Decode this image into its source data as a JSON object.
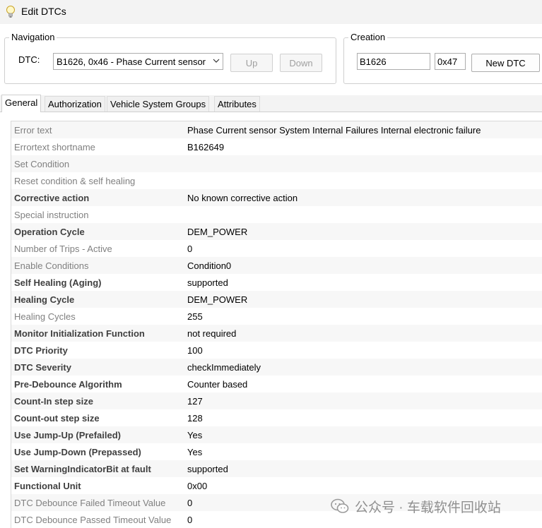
{
  "window": {
    "title": "Edit DTCs",
    "icon": "lightbulb-icon"
  },
  "navigation": {
    "legend": "Navigation",
    "dtc_label": "DTC:",
    "dtc_selected": "B1626, 0x46 - Phase Current sensor",
    "up_label": "Up",
    "down_label": "Down"
  },
  "creation": {
    "legend": "Creation",
    "code_value": "B1626",
    "byte_value": "0x47",
    "new_label": "New DTC"
  },
  "tabs": [
    {
      "label": "General",
      "active": true
    },
    {
      "label": "Authorization",
      "active": false
    },
    {
      "label": "Vehicle System Groups",
      "active": false
    },
    {
      "label": "Attributes",
      "active": false
    }
  ],
  "properties": [
    {
      "name": "Error text",
      "value": "Phase Current sensor System Internal Failures Internal electronic failure",
      "bold": false
    },
    {
      "name": "Errortext shortname",
      "value": "B162649",
      "bold": false
    },
    {
      "name": "Set Condition",
      "value": "",
      "bold": false
    },
    {
      "name": "Reset condition & self healing",
      "value": "",
      "bold": false
    },
    {
      "name": "Corrective action",
      "value": "No known corrective action",
      "bold": true
    },
    {
      "name": "Special instruction",
      "value": "",
      "bold": false
    },
    {
      "name": "Operation Cycle",
      "value": "DEM_POWER",
      "bold": true
    },
    {
      "name": "Number of Trips - Active",
      "value": "0",
      "bold": false
    },
    {
      "name": "Enable Conditions",
      "value": "Condition0",
      "bold": false
    },
    {
      "name": "Self Healing (Aging)",
      "value": "supported",
      "bold": true
    },
    {
      "name": "Healing Cycle",
      "value": "DEM_POWER",
      "bold": true
    },
    {
      "name": "Healing Cycles",
      "value": "255",
      "bold": false
    },
    {
      "name": "Monitor Initialization Function",
      "value": "not required",
      "bold": true
    },
    {
      "name": "DTC Priority",
      "value": "100",
      "bold": true
    },
    {
      "name": "DTC Severity",
      "value": "checkImmediately",
      "bold": true
    },
    {
      "name": "Pre-Debounce Algorithm",
      "value": "Counter based",
      "bold": true
    },
    {
      "name": "Count-In step size",
      "value": "127",
      "bold": true
    },
    {
      "name": "Count-out step size",
      "value": "128",
      "bold": true
    },
    {
      "name": "Use Jump-Up (Prefailed)",
      "value": "Yes",
      "bold": true
    },
    {
      "name": "Use Jump-Down (Prepassed)",
      "value": "Yes",
      "bold": true
    },
    {
      "name": "Set WarningIndicatorBit at fault",
      "value": "supported",
      "bold": true
    },
    {
      "name": "Functional Unit",
      "value": "0x00",
      "bold": true
    },
    {
      "name": "DTC Debounce Failed Timeout Value",
      "value": "0",
      "bold": false
    },
    {
      "name": "DTC Debounce Passed Timeout Value",
      "value": "0",
      "bold": false
    }
  ],
  "watermark": {
    "text": "公众号 · 车载软件回收站",
    "icon": "wechat-icon"
  },
  "colors": {
    "title_bg": "#f3f3f3",
    "row_alt": "#f7f7f7",
    "label_gray": "#808080"
  }
}
